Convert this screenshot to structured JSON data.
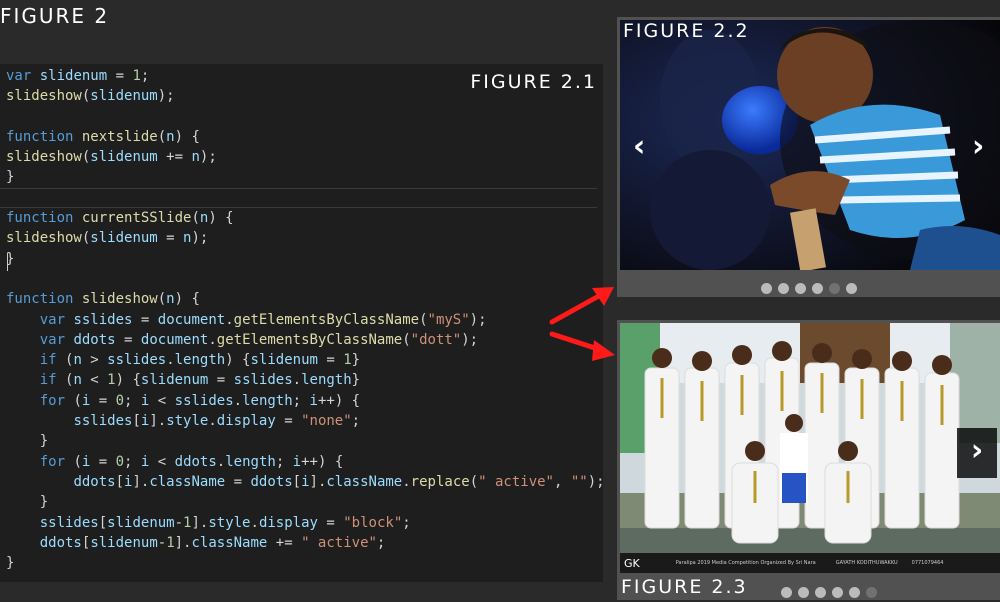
{
  "figure_main": "FIGURE 2",
  "code_panel": {
    "label": "FIGURE 2.1",
    "lines": [
      [
        [
          "kw",
          "var"
        ],
        [
          "t",
          " "
        ],
        [
          "vr",
          "slidenum"
        ],
        [
          "t",
          " = "
        ],
        [
          "num",
          "1"
        ],
        [
          "t",
          ";"
        ]
      ],
      [
        [
          "fn",
          "slideshow"
        ],
        [
          "t",
          "("
        ],
        [
          "vr",
          "slidenum"
        ],
        [
          "t",
          ");"
        ]
      ],
      [],
      [
        [
          "kw",
          "function"
        ],
        [
          "t",
          " "
        ],
        [
          "fn",
          "nextslide"
        ],
        [
          "t",
          "("
        ],
        [
          "vr",
          "n"
        ],
        [
          "t",
          ") {"
        ]
      ],
      [
        [
          "fn",
          "slideshow"
        ],
        [
          "t",
          "("
        ],
        [
          "vr",
          "slidenum"
        ],
        [
          "t",
          " += "
        ],
        [
          "vr",
          "n"
        ],
        [
          "t",
          ");"
        ]
      ],
      [
        [
          "t",
          "}"
        ]
      ],
      [],
      [
        [
          "kw",
          "function"
        ],
        [
          "t",
          " "
        ],
        [
          "fn",
          "currentSSlide"
        ],
        [
          "t",
          "("
        ],
        [
          "vr",
          "n"
        ],
        [
          "t",
          ") {"
        ]
      ],
      [
        [
          "fn",
          "slideshow"
        ],
        [
          "t",
          "("
        ],
        [
          "vr",
          "slidenum"
        ],
        [
          "t",
          " = "
        ],
        [
          "vr",
          "n"
        ],
        [
          "t",
          ");"
        ]
      ],
      [
        [
          "t",
          "}"
        ]
      ],
      [],
      [
        [
          "kw",
          "function"
        ],
        [
          "t",
          " "
        ],
        [
          "fn",
          "slideshow"
        ],
        [
          "t",
          "("
        ],
        [
          "vr",
          "n"
        ],
        [
          "t",
          ") {"
        ]
      ],
      [
        [
          "t",
          "    "
        ],
        [
          "kw",
          "var"
        ],
        [
          "t",
          " "
        ],
        [
          "vr",
          "sslides"
        ],
        [
          "t",
          " = "
        ],
        [
          "vr",
          "document"
        ],
        [
          "t",
          "."
        ],
        [
          "fn",
          "getElementsByClassName"
        ],
        [
          "t",
          "("
        ],
        [
          "str",
          "\"myS\""
        ],
        [
          "t",
          ");"
        ]
      ],
      [
        [
          "t",
          "    "
        ],
        [
          "kw",
          "var"
        ],
        [
          "t",
          " "
        ],
        [
          "vr",
          "ddots"
        ],
        [
          "t",
          " = "
        ],
        [
          "vr",
          "document"
        ],
        [
          "t",
          "."
        ],
        [
          "fn",
          "getElementsByClassName"
        ],
        [
          "t",
          "("
        ],
        [
          "str",
          "\"dott\""
        ],
        [
          "t",
          ");"
        ]
      ],
      [
        [
          "t",
          "    "
        ],
        [
          "kw",
          "if"
        ],
        [
          "t",
          " ("
        ],
        [
          "vr",
          "n"
        ],
        [
          "t",
          " > "
        ],
        [
          "vr",
          "sslides"
        ],
        [
          "t",
          "."
        ],
        [
          "vr",
          "length"
        ],
        [
          "t",
          ") {"
        ],
        [
          "vr",
          "slidenum"
        ],
        [
          "t",
          " = "
        ],
        [
          "num",
          "1"
        ],
        [
          "t",
          "}"
        ]
      ],
      [
        [
          "t",
          "    "
        ],
        [
          "kw",
          "if"
        ],
        [
          "t",
          " ("
        ],
        [
          "vr",
          "n"
        ],
        [
          "t",
          " < "
        ],
        [
          "num",
          "1"
        ],
        [
          "t",
          ") {"
        ],
        [
          "vr",
          "slidenum"
        ],
        [
          "t",
          " = "
        ],
        [
          "vr",
          "sslides"
        ],
        [
          "t",
          "."
        ],
        [
          "vr",
          "length"
        ],
        [
          "t",
          "}"
        ]
      ],
      [
        [
          "t",
          "    "
        ],
        [
          "kw",
          "for"
        ],
        [
          "t",
          " ("
        ],
        [
          "vr",
          "i"
        ],
        [
          "t",
          " = "
        ],
        [
          "num",
          "0"
        ],
        [
          "t",
          "; "
        ],
        [
          "vr",
          "i"
        ],
        [
          "t",
          " < "
        ],
        [
          "vr",
          "sslides"
        ],
        [
          "t",
          "."
        ],
        [
          "vr",
          "length"
        ],
        [
          "t",
          "; "
        ],
        [
          "vr",
          "i"
        ],
        [
          "t",
          "++) {"
        ]
      ],
      [
        [
          "t",
          "        "
        ],
        [
          "vr",
          "sslides"
        ],
        [
          "t",
          "["
        ],
        [
          "vr",
          "i"
        ],
        [
          "t",
          "]."
        ],
        [
          "vr",
          "style"
        ],
        [
          "t",
          "."
        ],
        [
          "vr",
          "display"
        ],
        [
          "t",
          " = "
        ],
        [
          "str",
          "\"none\""
        ],
        [
          "t",
          ";"
        ]
      ],
      [
        [
          "t",
          "    }"
        ]
      ],
      [
        [
          "t",
          "    "
        ],
        [
          "kw",
          "for"
        ],
        [
          "t",
          " ("
        ],
        [
          "vr",
          "i"
        ],
        [
          "t",
          " = "
        ],
        [
          "num",
          "0"
        ],
        [
          "t",
          "; "
        ],
        [
          "vr",
          "i"
        ],
        [
          "t",
          " < "
        ],
        [
          "vr",
          "ddots"
        ],
        [
          "t",
          "."
        ],
        [
          "vr",
          "length"
        ],
        [
          "t",
          "; "
        ],
        [
          "vr",
          "i"
        ],
        [
          "t",
          "++) {"
        ]
      ],
      [
        [
          "t",
          "        "
        ],
        [
          "vr",
          "ddots"
        ],
        [
          "t",
          "["
        ],
        [
          "vr",
          "i"
        ],
        [
          "t",
          "]."
        ],
        [
          "vr",
          "className"
        ],
        [
          "t",
          " = "
        ],
        [
          "vr",
          "ddots"
        ],
        [
          "t",
          "["
        ],
        [
          "vr",
          "i"
        ],
        [
          "t",
          "]."
        ],
        [
          "vr",
          "className"
        ],
        [
          "t",
          "."
        ],
        [
          "fn",
          "replace"
        ],
        [
          "t",
          "("
        ],
        [
          "str",
          "\" active\""
        ],
        [
          "t",
          ", "
        ],
        [
          "str",
          "\"\""
        ],
        [
          "t",
          ");"
        ]
      ],
      [
        [
          "t",
          "    }"
        ]
      ],
      [
        [
          "t",
          "    "
        ],
        [
          "vr",
          "sslides"
        ],
        [
          "t",
          "["
        ],
        [
          "vr",
          "slidenum"
        ],
        [
          "t",
          "-"
        ],
        [
          "num",
          "1"
        ],
        [
          "t",
          "]."
        ],
        [
          "vr",
          "style"
        ],
        [
          "t",
          "."
        ],
        [
          "vr",
          "display"
        ],
        [
          "t",
          " = "
        ],
        [
          "str",
          "\"block\""
        ],
        [
          "t",
          ";"
        ]
      ],
      [
        [
          "t",
          "    "
        ],
        [
          "vr",
          "ddots"
        ],
        [
          "t",
          "["
        ],
        [
          "vr",
          "slidenum"
        ],
        [
          "t",
          "-"
        ],
        [
          "num",
          "1"
        ],
        [
          "t",
          "]."
        ],
        [
          "vr",
          "className"
        ],
        [
          "t",
          " += "
        ],
        [
          "str",
          "\" active\""
        ],
        [
          "t",
          ";"
        ]
      ],
      [
        [
          "t",
          "}"
        ]
      ]
    ]
  },
  "slider1": {
    "label": "FIGURE 2.2",
    "prev_label": "‹",
    "next_label": "›",
    "dot_count": 6,
    "active_dot": 4
  },
  "slider2": {
    "label": "FIGURE 2.3",
    "next_label": "›",
    "dot_count": 6,
    "active_dot": 5,
    "banner": {
      "logo": "GK",
      "text_left": "Paralipa 2019 Media Competition Organized By Sri Nara",
      "text_mid": "GAYATH KODITHUWAKKU",
      "text_right": "0771079464"
    }
  },
  "colors": {
    "code_bg": "#1e1e1e",
    "page_bg": "#2a2a2b",
    "keyword": "#569cd6",
    "function": "#dcdcaa",
    "string": "#ce9178",
    "arrow": "#ff1a1a"
  }
}
